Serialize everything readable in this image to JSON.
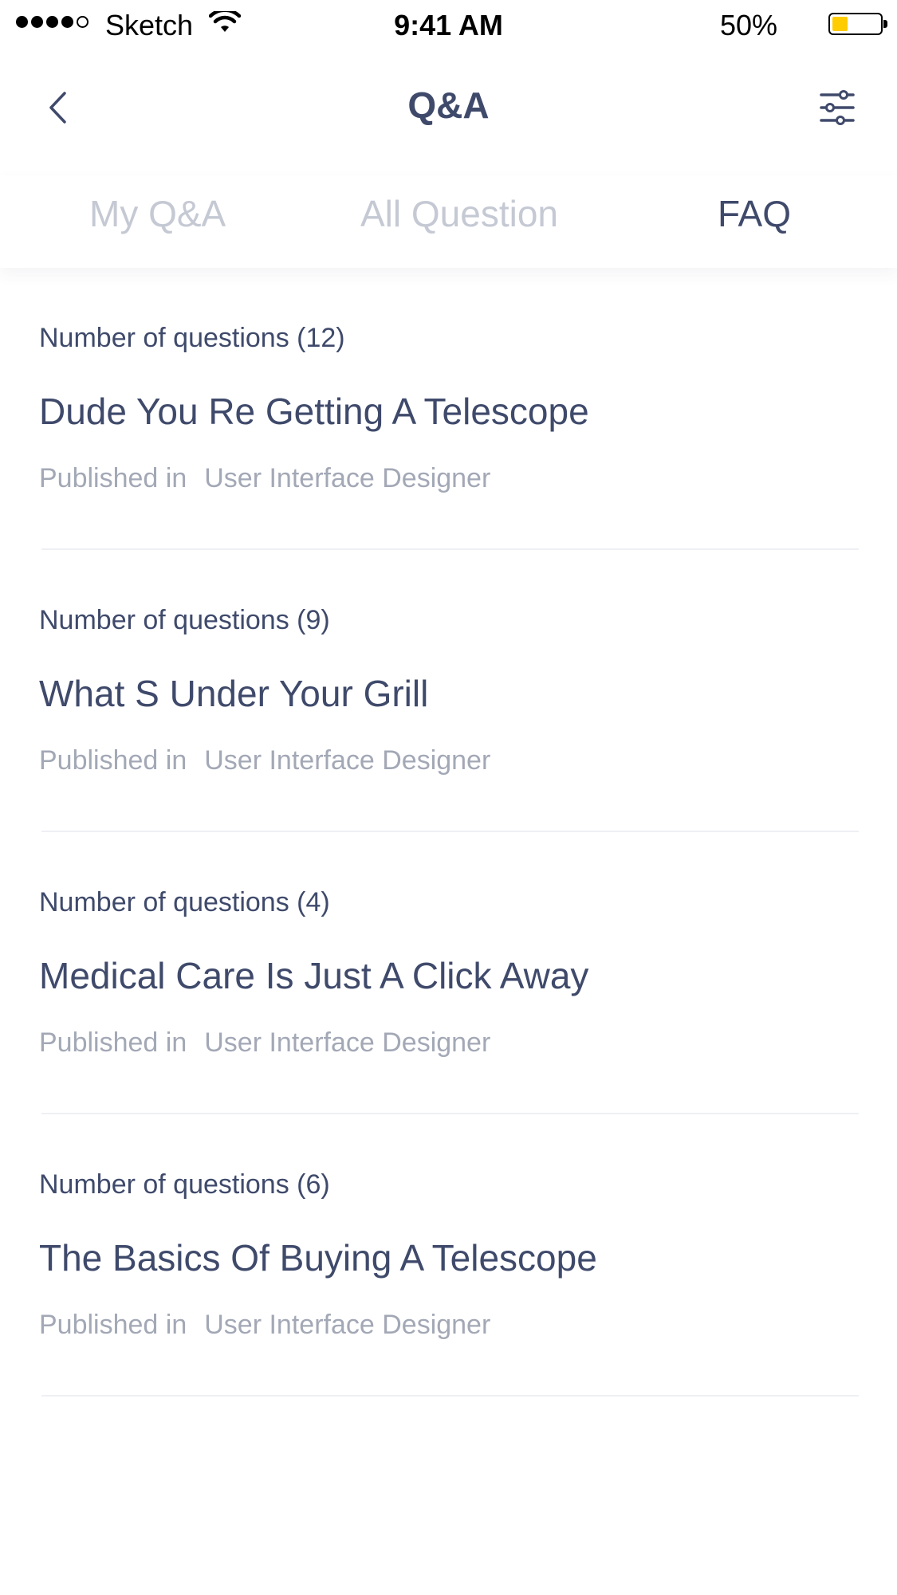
{
  "status_bar": {
    "carrier": "Sketch",
    "time": "9:41 AM",
    "battery_percent": "50%",
    "battery_level": 0.5,
    "battery_color": "#ffcc00",
    "signal_bars_filled": 4,
    "signal_bars_total": 5
  },
  "header": {
    "title": "Q&A",
    "back_icon": "chevron-left-icon",
    "filter_icon": "sliders-icon"
  },
  "tabs": [
    {
      "label": "My Q&A",
      "active": false
    },
    {
      "label": "All Question",
      "active": false
    },
    {
      "label": "FAQ",
      "active": true
    }
  ],
  "faq_items": [
    {
      "count_label": "Number of questions (12)",
      "title": "Dude You Re Getting A Telescope",
      "published_label": "Published in",
      "category": "User Interface Designer"
    },
    {
      "count_label": "Number of questions (9)",
      "title": "What S Under Your Grill",
      "published_label": "Published in",
      "category": "User Interface Designer"
    },
    {
      "count_label": "Number of questions (4)",
      "title": "Medical Care Is Just A Click Away",
      "published_label": "Published in",
      "category": "User Interface Designer"
    },
    {
      "count_label": "Number of questions (6)",
      "title": "The Basics Of Buying A Telescope",
      "published_label": "Published in",
      "category": "User Interface Designer"
    }
  ],
  "colors": {
    "text_primary": "#3f4a6b",
    "text_muted": "#a3a8b6",
    "tab_inactive": "#c5c9d3",
    "divider": "#eef0f4"
  }
}
